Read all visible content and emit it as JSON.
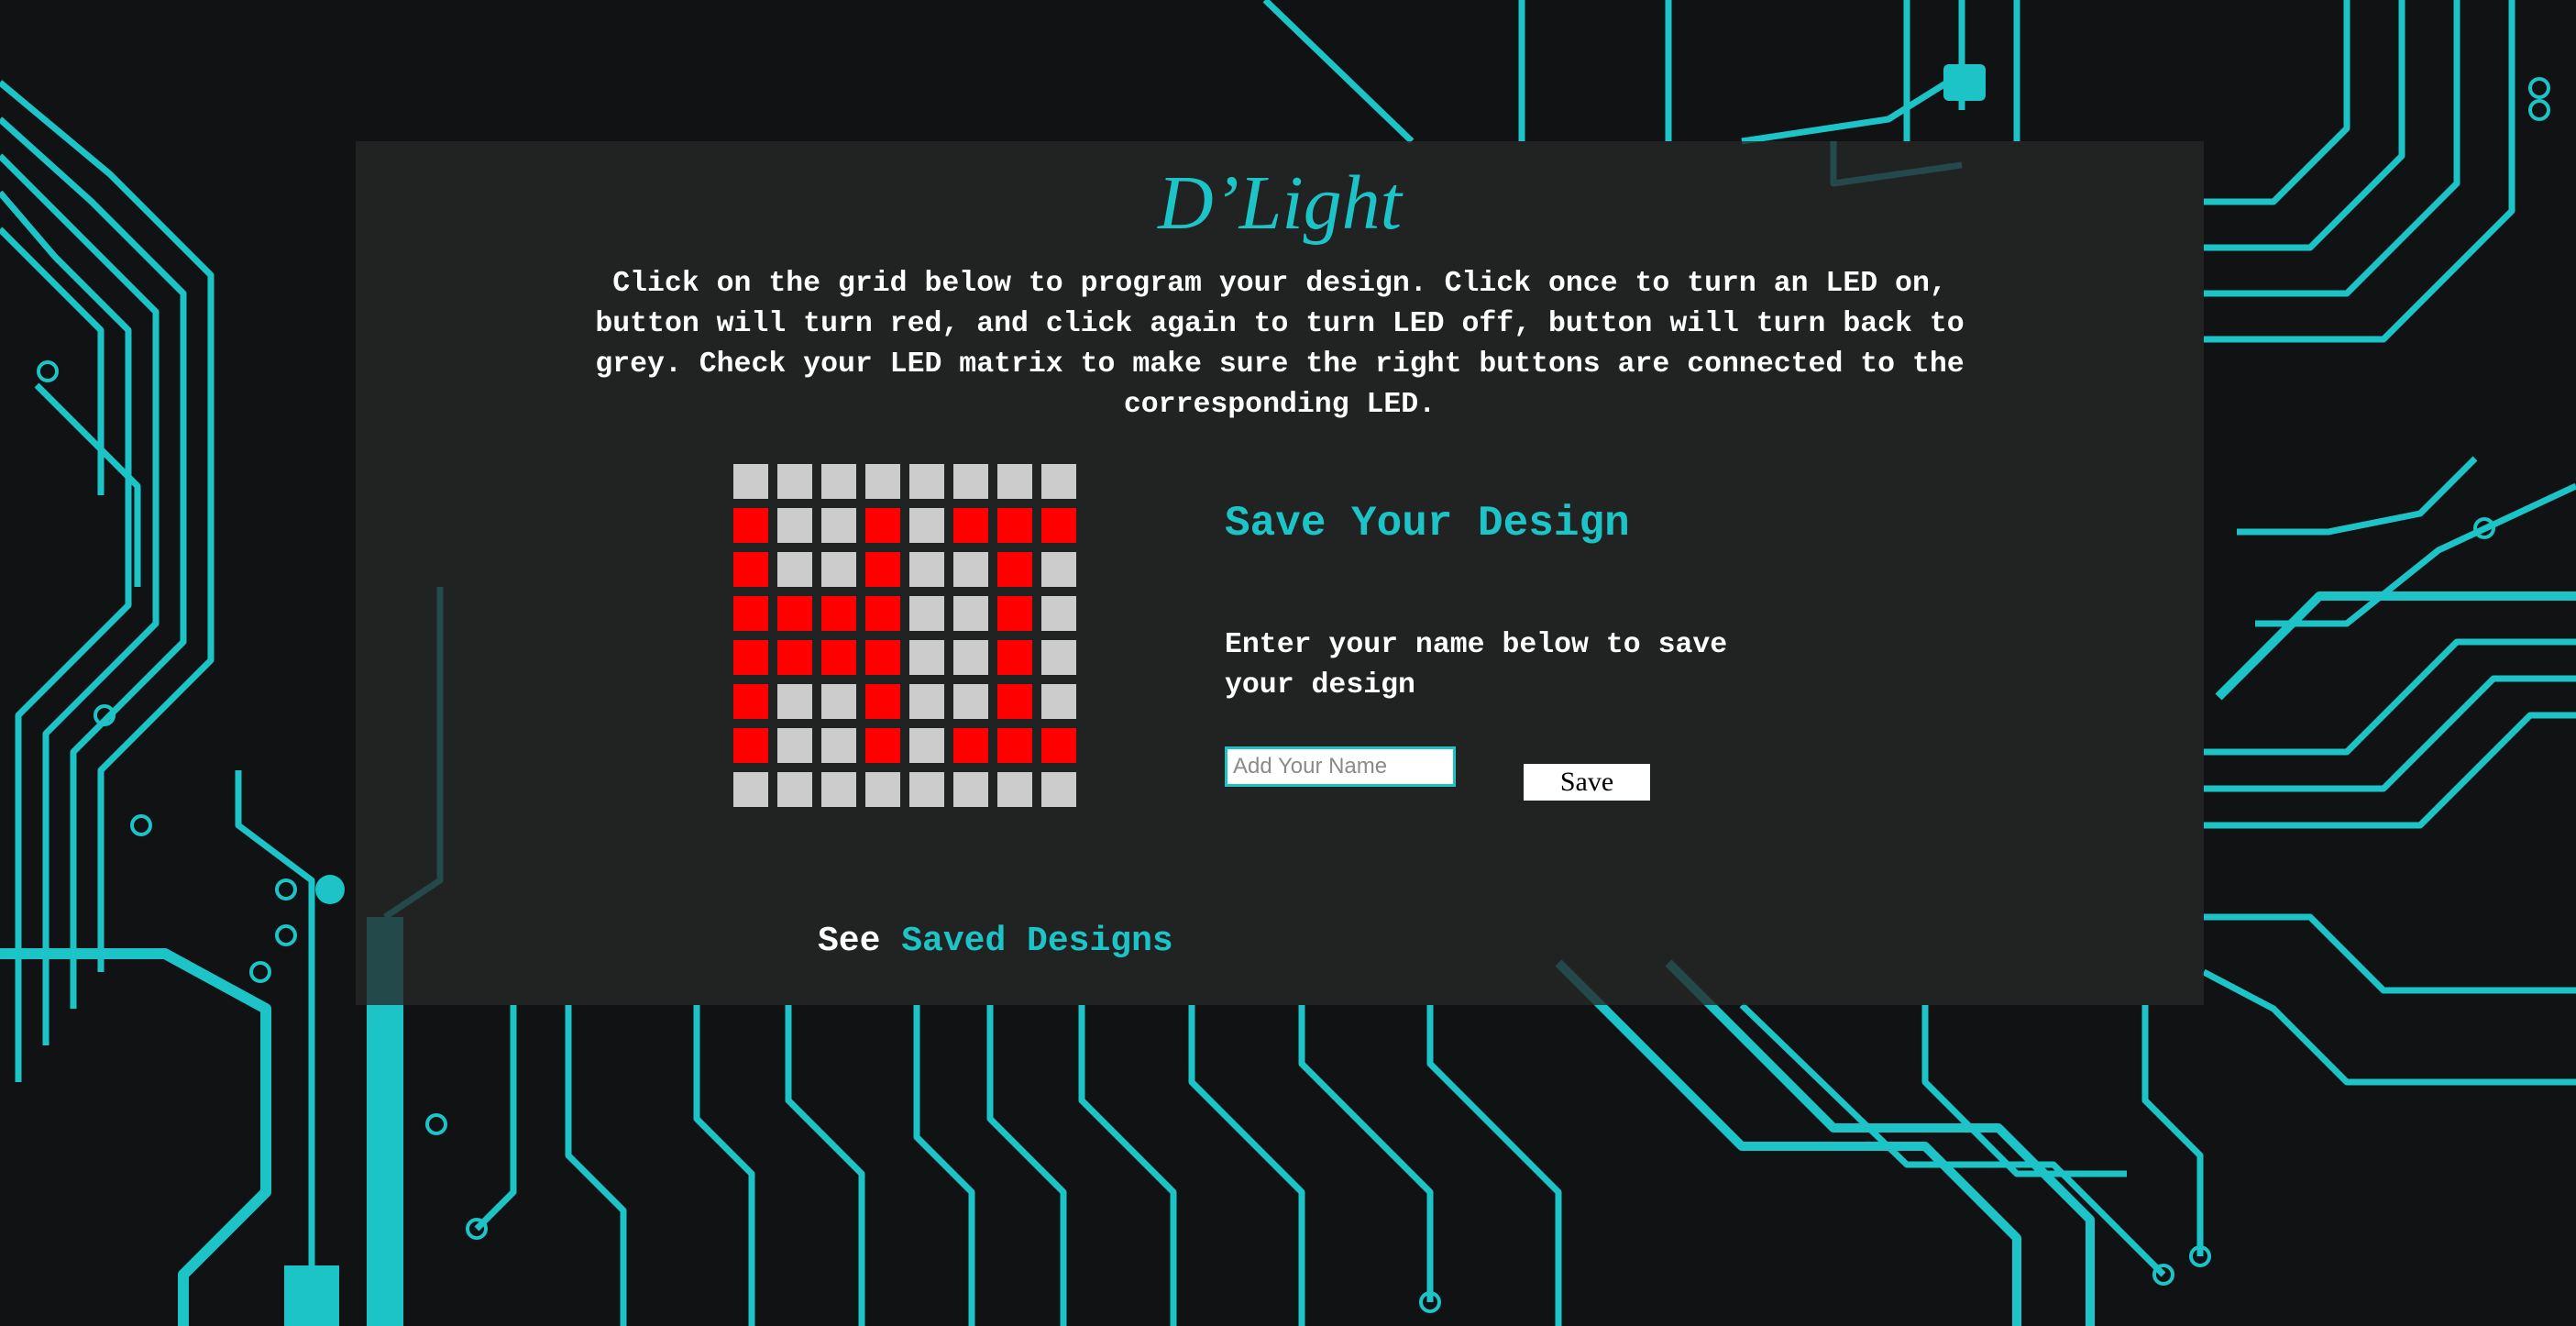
{
  "app": {
    "title": "D’Light",
    "instructions": "Click on the grid below to program your design. Click once to turn an LED on, button will turn red, and click again to turn LED off, button will turn back to grey. Check your LED matrix to make sure the right buttons are connected to the corresponding LED."
  },
  "led_grid": {
    "rows": 8,
    "cols": 8,
    "on_color": "#ff0000",
    "off_color": "#cccccc",
    "state": [
      [
        0,
        0,
        0,
        0,
        0,
        0,
        0,
        0
      ],
      [
        1,
        0,
        0,
        1,
        0,
        1,
        1,
        1
      ],
      [
        1,
        0,
        0,
        1,
        0,
        0,
        1,
        0
      ],
      [
        1,
        1,
        1,
        1,
        0,
        0,
        1,
        0
      ],
      [
        1,
        1,
        1,
        1,
        0,
        0,
        1,
        0
      ],
      [
        1,
        0,
        0,
        1,
        0,
        0,
        1,
        0
      ],
      [
        1,
        0,
        0,
        1,
        0,
        1,
        1,
        1
      ],
      [
        0,
        0,
        0,
        0,
        0,
        0,
        0,
        0
      ]
    ]
  },
  "save": {
    "title": "Save Your Design",
    "prompt": "Enter your name below to save your design",
    "name_placeholder": "Add Your Name",
    "name_value": "",
    "button_label": "Save"
  },
  "footer": {
    "see_label": "See",
    "saved_designs_link": "Saved Designs"
  },
  "colors": {
    "accent": "#1cc4c8",
    "background": "#111213",
    "panel": "#262626",
    "text": "#ffffff"
  }
}
